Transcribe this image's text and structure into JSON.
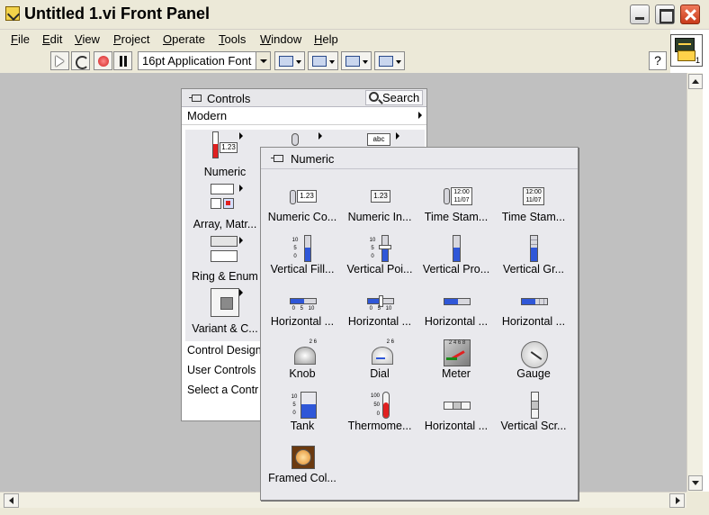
{
  "window": {
    "title": "Untitled 1.vi Front Panel"
  },
  "menu": [
    "File",
    "Edit",
    "View",
    "Project",
    "Operate",
    "Tools",
    "Window",
    "Help"
  ],
  "vi_icon_number": "1",
  "toolbar": {
    "font": "16pt Application Font",
    "help": "?"
  },
  "controls_palette": {
    "title": "Controls",
    "search": "Search",
    "subpalette": "Modern",
    "categories": [
      {
        "label": "Numeric",
        "icon": "numeric-icon"
      },
      {
        "label": "",
        "icon": "boolean-icon"
      },
      {
        "label": "",
        "icon": "string-icon"
      },
      {
        "label": "Array, Matr...",
        "icon": "array-matrix-icon"
      },
      {
        "label": "Ring & Enum",
        "icon": "ring-enum-icon"
      },
      {
        "label": "Variant & C...",
        "icon": "variant-icon"
      }
    ],
    "string_icon_text": "abc",
    "rows": [
      "Control Design",
      "User Controls",
      "Select a Contr"
    ]
  },
  "numeric_palette": {
    "title": "Numeric",
    "items": [
      {
        "label": "Numeric Co...",
        "icon": "numeric-control-icon",
        "text": "1.23"
      },
      {
        "label": "Numeric In...",
        "icon": "numeric-indicator-icon",
        "text": "1.23"
      },
      {
        "label": "Time Stam...",
        "icon": "time-stamp-control-icon",
        "text": "12:00 11/07"
      },
      {
        "label": "Time Stam...",
        "icon": "time-stamp-indicator-icon",
        "text": "12:00 11/07"
      },
      {
        "label": "Vertical Fill...",
        "icon": "vertical-fill-slide-icon",
        "text": "10 5 0"
      },
      {
        "label": "Vertical Poi...",
        "icon": "vertical-pointer-slide-icon",
        "text": "10 5 0"
      },
      {
        "label": "Vertical Pro...",
        "icon": "vertical-progress-bar-icon",
        "text": ""
      },
      {
        "label": "Vertical Gr...",
        "icon": "vertical-graduated-bar-icon",
        "text": ""
      },
      {
        "label": "Horizontal ...",
        "icon": "horizontal-fill-slide-icon",
        "text": "0 5 10"
      },
      {
        "label": "Horizontal ...",
        "icon": "horizontal-pointer-slide-icon",
        "text": "0 5 10"
      },
      {
        "label": "Horizontal ...",
        "icon": "horizontal-progress-bar-icon",
        "text": ""
      },
      {
        "label": "Horizontal ...",
        "icon": "horizontal-graduated-bar-icon",
        "text": ""
      },
      {
        "label": "Knob",
        "icon": "knob-icon",
        "text": "2 6"
      },
      {
        "label": "Dial",
        "icon": "dial-icon",
        "text": "2 6"
      },
      {
        "label": "Meter",
        "icon": "meter-icon",
        "text": "2 4 6 8"
      },
      {
        "label": "Gauge",
        "icon": "gauge-icon",
        "text": ""
      },
      {
        "label": "Tank",
        "icon": "tank-icon",
        "text": "10 5 0"
      },
      {
        "label": "Thermome...",
        "icon": "thermometer-icon",
        "text": "100 50 0"
      },
      {
        "label": "Horizontal ...",
        "icon": "horizontal-scrollbar-icon",
        "text": ""
      },
      {
        "label": "Vertical Scr...",
        "icon": "vertical-scrollbar-icon",
        "text": ""
      },
      {
        "label": "Framed Col...",
        "icon": "framed-color-box-icon",
        "text": ""
      }
    ]
  },
  "colors": {
    "chrome": "#ece9d8",
    "panel": "#c0c0c0",
    "palette_bg": "#e9e9ed",
    "fill_blue": "#2f57d8",
    "close_red": "#c83a1a"
  }
}
